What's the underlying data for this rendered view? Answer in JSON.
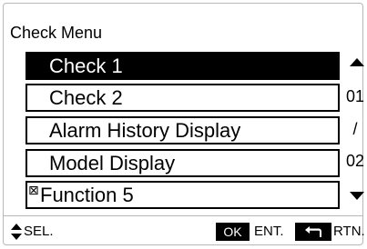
{
  "title": "Check Menu",
  "menu": {
    "items": [
      {
        "label": "Check 1",
        "selected": true
      },
      {
        "label": "Check 2",
        "selected": false
      },
      {
        "label": "Alarm History Display",
        "selected": false
      },
      {
        "label": "Model Display",
        "selected": false
      },
      {
        "label": "Function 5",
        "selected": false,
        "checkbox_glyph": "⊠"
      }
    ]
  },
  "page_indicator": {
    "current": "01",
    "separator": "/",
    "total": "02"
  },
  "icons": {
    "scroll_up": "triangle-up",
    "scroll_down": "triangle-down",
    "select": "up-down-arrows",
    "return": "return-arrow"
  },
  "footer": {
    "select_label": "SEL.",
    "ok_badge": "OK",
    "enter_label": "ENT.",
    "return_label": "RTN."
  }
}
